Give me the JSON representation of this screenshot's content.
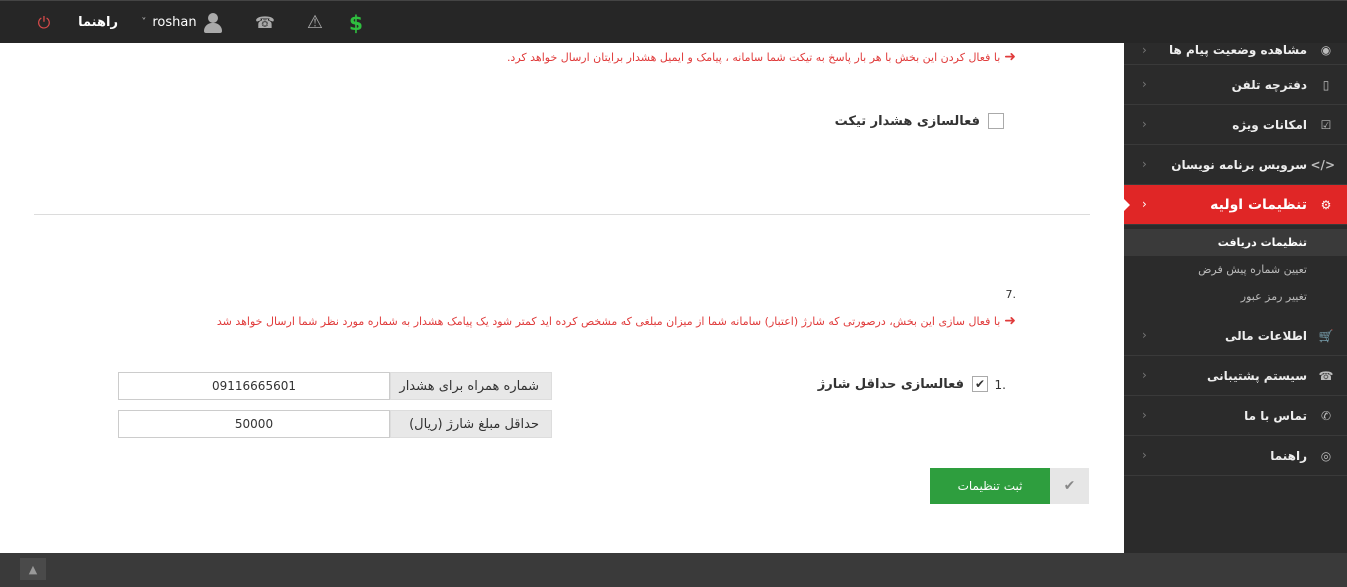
{
  "topbar": {
    "help_label": "راهنما",
    "username": "roshan",
    "user_chevron": "˅",
    "power_glyph": "⏻",
    "phone_glyph": "☎",
    "warning_glyph": "⚠",
    "dollar_glyph": "$"
  },
  "main": {
    "warning_1": "با فعال کردن این بخش با هر بار پاسخ به تیکت شما سامانه ، پیامک و ایمیل هشدار برایتان ارسال خواهد کرد.",
    "ticket_alert_label": "فعالسازی هشدار تیکت",
    "ticket_alert_checked": false,
    "section_number": "7.",
    "warning_2": "با فعال سازی این بخش، درصورتی که شارژ (اعتبار) سامانه شما از میزان مبلغی که مشخص کرده اید کمتر شود یک پیامک هشدار به شماره مورد نظر شما ارسال خواهد شد",
    "item_number": "1.",
    "min_charge_label": "فعالسازی حداقل شارژ",
    "min_charge_checked": true,
    "mobile_label": "شماره همراه برای هشدار",
    "mobile_value": "09116665601",
    "min_amount_label": "حداقل مبلغ شارژ (ریال)",
    "min_amount_value": "50000",
    "save_label": "ثبت تنظیمات",
    "check_glyph": "✔",
    "arrow_glyph": "➜"
  },
  "sidebar": {
    "items": [
      {
        "label": "مشاهده وضعیت پیام ها",
        "icon": "eye-icon",
        "glyph": "◉"
      },
      {
        "label": "دفترچه تلفن",
        "icon": "phone-book-icon",
        "glyph": "▯"
      },
      {
        "label": "امکانات ویژه",
        "icon": "checkbox-icon",
        "glyph": "☑"
      },
      {
        "label": "سرویس برنامه نویسان",
        "icon": "code-icon",
        "glyph": "</>"
      },
      {
        "label": "تنظیمات اولیه",
        "icon": "gear-icon",
        "glyph": "⚙"
      },
      {
        "label": "اطلاعات مالی",
        "icon": "cart-icon",
        "glyph": "🛒"
      },
      {
        "label": "سیستم پشتیبانی",
        "icon": "phone-icon",
        "glyph": "☎"
      },
      {
        "label": "تماس با ما",
        "icon": "handset-icon",
        "glyph": "✆"
      },
      {
        "label": "راهنما",
        "icon": "lifebuoy-icon",
        "glyph": "◎"
      }
    ],
    "submenu": [
      {
        "label": "تنظیمات دریافت"
      },
      {
        "label": "تعیین شماره پیش فرض"
      },
      {
        "label": "تغییر رمز عبور"
      }
    ],
    "chevron": "‹"
  },
  "footer": {
    "up_glyph": "▲"
  }
}
